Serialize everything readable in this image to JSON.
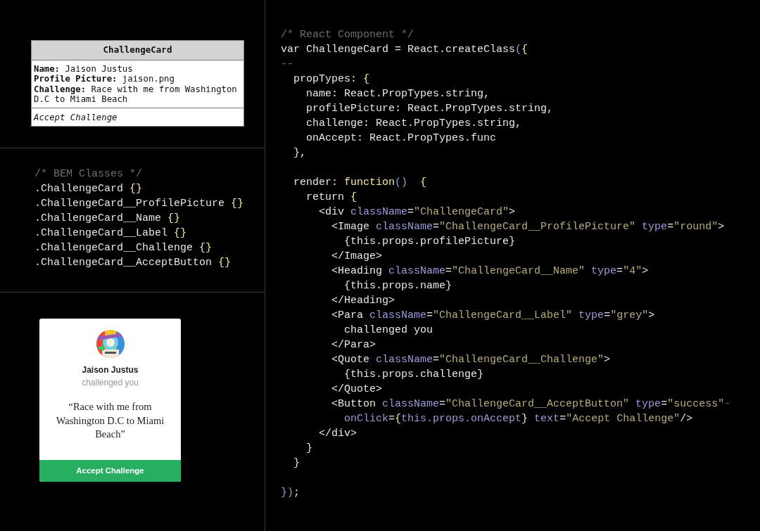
{
  "uml_card": {
    "title": "ChallengeCard",
    "fields": [
      {
        "label": "Name:",
        "value": "Jaison Justus"
      },
      {
        "label": "Profile Picture:",
        "value": "jaison.png"
      },
      {
        "label": "Challenge:",
        "value": "Race with me from Washington D.C to Miami Beach"
      }
    ],
    "action": "Accept Challenge"
  },
  "bem_classes": [
    [
      {
        "text": "/* BEM Classes */",
        "kind": "comment"
      }
    ],
    [
      {
        "text": ".ChallengeCard ",
        "kind": "plain"
      },
      {
        "text": "{}",
        "kind": "brace"
      }
    ],
    [
      {
        "text": ".ChallengeCard__ProfilePicture ",
        "kind": "plain"
      },
      {
        "text": "{}",
        "kind": "brace"
      }
    ],
    [
      {
        "text": ".ChallengeCard__Name ",
        "kind": "plain"
      },
      {
        "text": "{}",
        "kind": "brace"
      }
    ],
    [
      {
        "text": ".ChallengeCard__Label ",
        "kind": "plain"
      },
      {
        "text": "{}",
        "kind": "brace"
      }
    ],
    [
      {
        "text": ".ChallengeCard__Challenge ",
        "kind": "plain"
      },
      {
        "text": "{}",
        "kind": "brace"
      }
    ],
    [
      {
        "text": ".ChallengeCard__AcceptButton ",
        "kind": "plain"
      },
      {
        "text": "{}",
        "kind": "brace"
      }
    ]
  ],
  "preview_card": {
    "name": "Jaison Justus",
    "label": "challenged you",
    "quote": "“Race with me from Washington D.C to Miami Beach”",
    "button": "Accept Challenge"
  },
  "code": [
    {
      "tokens": [
        {
          "text": "/* React Component */",
          "kind": "comment"
        }
      ]
    },
    {
      "tokens": [
        {
          "text": "var ChallengeCard = React.createClass",
          "kind": "plain"
        },
        {
          "text": "(",
          "kind": "paren"
        },
        {
          "text": "{",
          "kind": "brace"
        }
      ]
    },
    {
      "tokens": [
        {
          "text": "--",
          "kind": "comment"
        }
      ]
    },
    {
      "tokens": [
        {
          "text": "  propTypes: ",
          "kind": "plain"
        },
        {
          "text": "{",
          "kind": "brace"
        }
      ]
    },
    {
      "tokens": [
        {
          "text": "    name: React.PropTypes.string,",
          "kind": "plain"
        }
      ]
    },
    {
      "tokens": [
        {
          "text": "    profilePicture: React.PropTypes.string,",
          "kind": "plain"
        }
      ]
    },
    {
      "tokens": [
        {
          "text": "    challenge: React.PropTypes.string,",
          "kind": "plain"
        }
      ]
    },
    {
      "tokens": [
        {
          "text": "    onAccept: React.PropTypes.func",
          "kind": "plain"
        }
      ]
    },
    {
      "tokens": [
        {
          "text": "  }",
          "kind": "brace"
        },
        {
          "text": ",",
          "kind": "plain"
        }
      ]
    },
    {
      "kind": "blank"
    },
    {
      "tokens": [
        {
          "text": "  render: ",
          "kind": "plain"
        },
        {
          "text": "function",
          "kind": "brace"
        },
        {
          "text": "()",
          "kind": "paren"
        },
        {
          "text": "  {",
          "kind": "brace"
        }
      ]
    },
    {
      "tokens": [
        {
          "text": "    return ",
          "kind": "plain"
        },
        {
          "text": "{",
          "kind": "brace"
        }
      ]
    },
    {
      "tokens": [
        {
          "text": "      <div ",
          "kind": "plain"
        },
        {
          "text": "className",
          "kind": "attr"
        },
        {
          "text": "=",
          "kind": "plain"
        },
        {
          "text": "\"ChallengeCard\"",
          "kind": "string"
        },
        {
          "text": ">",
          "kind": "plain"
        }
      ]
    },
    {
      "tokens": [
        {
          "text": "        <Image ",
          "kind": "plain"
        },
        {
          "text": "className",
          "kind": "attr"
        },
        {
          "text": "=",
          "kind": "plain"
        },
        {
          "text": "\"ChallengeCard__ProfilePicture\"",
          "kind": "string"
        },
        {
          "text": " type",
          "kind": "attr"
        },
        {
          "text": "=",
          "kind": "plain"
        },
        {
          "text": "\"round\"",
          "kind": "string"
        },
        {
          "text": ">",
          "kind": "plain"
        }
      ]
    },
    {
      "tokens": [
        {
          "text": "          {this.props.profilePicture}",
          "kind": "plain"
        }
      ]
    },
    {
      "tokens": [
        {
          "text": "        </Image>",
          "kind": "plain"
        }
      ]
    },
    {
      "tokens": [
        {
          "text": "        <Heading ",
          "kind": "plain"
        },
        {
          "text": "className",
          "kind": "attr"
        },
        {
          "text": "=",
          "kind": "plain"
        },
        {
          "text": "\"ChallengeCard__Name\"",
          "kind": "string"
        },
        {
          "text": " type",
          "kind": "attr"
        },
        {
          "text": "=",
          "kind": "plain"
        },
        {
          "text": "\"4\"",
          "kind": "string"
        },
        {
          "text": ">",
          "kind": "plain"
        }
      ]
    },
    {
      "tokens": [
        {
          "text": "          {this.props.name}",
          "kind": "plain"
        }
      ]
    },
    {
      "tokens": [
        {
          "text": "        </Heading>",
          "kind": "plain"
        }
      ]
    },
    {
      "tokens": [
        {
          "text": "        <Para ",
          "kind": "plain"
        },
        {
          "text": "className",
          "kind": "attr"
        },
        {
          "text": "=",
          "kind": "plain"
        },
        {
          "text": "\"ChallengeCard__Label\"",
          "kind": "string"
        },
        {
          "text": " type",
          "kind": "attr"
        },
        {
          "text": "=",
          "kind": "plain"
        },
        {
          "text": "\"grey\"",
          "kind": "string"
        },
        {
          "text": ">",
          "kind": "plain"
        }
      ]
    },
    {
      "tokens": [
        {
          "text": "          challenged you",
          "kind": "plain"
        }
      ]
    },
    {
      "tokens": [
        {
          "text": "        </Para>",
          "kind": "plain"
        }
      ]
    },
    {
      "tokens": [
        {
          "text": "        <Quote ",
          "kind": "plain"
        },
        {
          "text": "className",
          "kind": "attr"
        },
        {
          "text": "=",
          "kind": "plain"
        },
        {
          "text": "\"ChallengeCard__Challenge\"",
          "kind": "string"
        },
        {
          "text": ">",
          "kind": "plain"
        }
      ]
    },
    {
      "tokens": [
        {
          "text": "          {this.props.challenge}",
          "kind": "plain"
        }
      ]
    },
    {
      "tokens": [
        {
          "text": "        </Quote>",
          "kind": "plain"
        }
      ]
    },
    {
      "tokens": [
        {
          "text": "        <Button ",
          "kind": "plain"
        },
        {
          "text": "className",
          "kind": "attr"
        },
        {
          "text": "=",
          "kind": "plain"
        },
        {
          "text": "\"ChallengeCard__AcceptButton\"",
          "kind": "string"
        },
        {
          "text": " type",
          "kind": "attr"
        },
        {
          "text": "=",
          "kind": "plain"
        },
        {
          "text": "\"success\"",
          "kind": "string"
        },
        {
          "text": "-",
          "kind": "comment"
        }
      ]
    },
    {
      "tokens": [
        {
          "text": "          onClick",
          "kind": "attr"
        },
        {
          "text": "=",
          "kind": "plain"
        },
        {
          "text": "{",
          "kind": "brace"
        },
        {
          "text": "this.props.onAccept",
          "kind": "attr"
        },
        {
          "text": "} ",
          "kind": "plain"
        },
        {
          "text": "text",
          "kind": "attr"
        },
        {
          "text": "=",
          "kind": "plain"
        },
        {
          "text": "\"Accept Challenge\"",
          "kind": "string"
        },
        {
          "text": "/>",
          "kind": "plain"
        }
      ]
    },
    {
      "tokens": [
        {
          "text": "      </div>",
          "kind": "plain"
        }
      ]
    },
    {
      "tokens": [
        {
          "text": "    }",
          "kind": "brace"
        }
      ]
    },
    {
      "tokens": [
        {
          "text": "  }",
          "kind": "brace"
        }
      ]
    },
    {
      "kind": "blank"
    },
    {
      "tokens": [
        {
          "text": "})",
          "kind": "paren"
        },
        {
          "text": ";",
          "kind": "plain"
        }
      ]
    }
  ]
}
